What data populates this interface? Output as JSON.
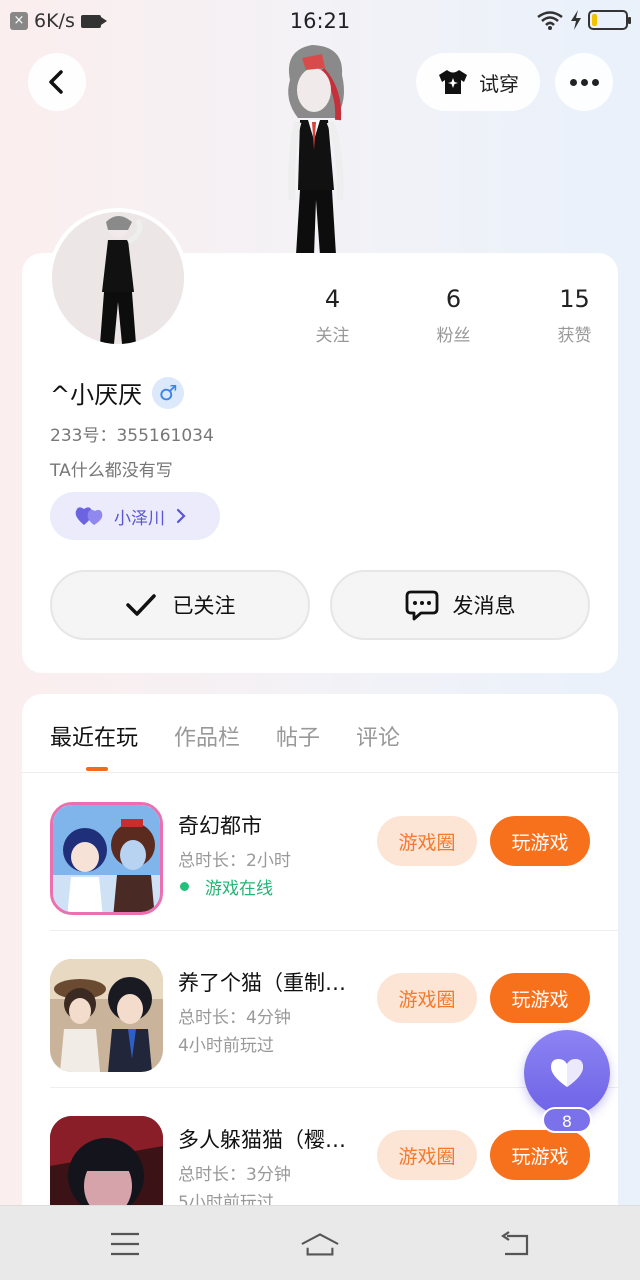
{
  "status_bar": {
    "speed": "6K/s",
    "time": "16:21",
    "battery_level": 0.15
  },
  "header": {
    "tryon_label": "试穿",
    "icons": [
      "back-arrow-icon",
      "tshirt-icon",
      "more-dots-icon"
    ]
  },
  "profile": {
    "stats": [
      {
        "value": "4",
        "label": "关注"
      },
      {
        "value": "6",
        "label": "粉丝"
      },
      {
        "value": "15",
        "label": "获赞"
      }
    ],
    "username": "^小厌厌",
    "gender_symbol": "♂",
    "uid": "233号：355161034",
    "bio": "TA什么都没有写",
    "relation_name": "小泽川",
    "follow_label": "已关注",
    "message_label": "发消息"
  },
  "tabs": [
    {
      "label": "最近在玩",
      "active": true
    },
    {
      "label": "作品栏",
      "active": false
    },
    {
      "label": "帖子",
      "active": false
    },
    {
      "label": "评论",
      "active": false
    }
  ],
  "games": [
    {
      "name": "奇幻都市",
      "duration": "总时长：2小时",
      "status": "游戏在线",
      "online": true,
      "circle_label": "游戏圈",
      "play_label": "玩游戏"
    },
    {
      "name": "养了个猫（重制…",
      "duration": "总时长：4分钟",
      "status": "4小时前玩过",
      "online": false,
      "circle_label": "游戏圈",
      "play_label": "玩游戏"
    },
    {
      "name": "多人躲猫猫（樱…",
      "duration": "总时长：3分钟",
      "status": "5小时前玩过",
      "online": false,
      "circle_label": "游戏圈",
      "play_label": "玩游戏"
    }
  ],
  "like_fab": {
    "count": "8"
  },
  "colors": {
    "accent_orange": "#f7701c",
    "online_green": "#22b573",
    "purple": "#6d63e6"
  }
}
